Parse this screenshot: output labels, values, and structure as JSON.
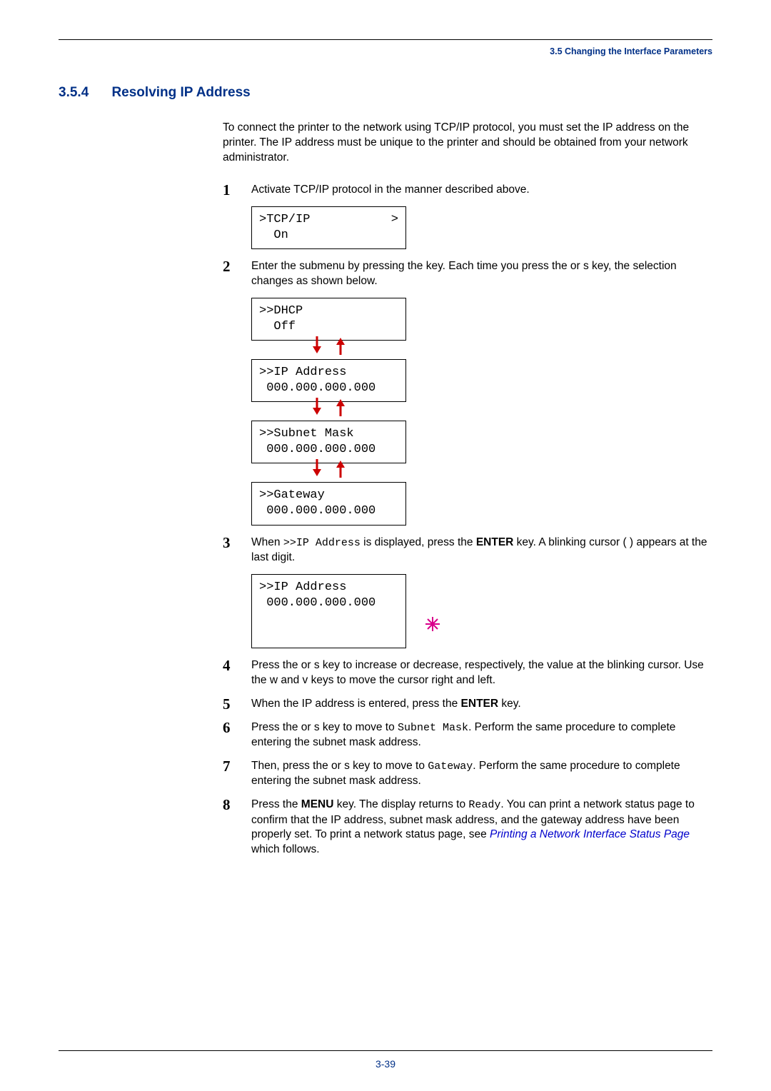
{
  "running_head": "3.5 Changing the Interface Parameters",
  "section": {
    "num": "3.5.4",
    "title": "Resolving IP Address"
  },
  "intro": "To connect the printer to the network using TCP/IP protocol, you must set the IP address on the printer. The IP address must be unique to the printer and should be obtained from your network administrator.",
  "steps": {
    "s1": {
      "num": "1",
      "text": "Activate TCP/IP protocol in the manner described above.",
      "lcd_l1": ">TCP/IP",
      "lcd_gt": ">",
      "lcd_l2": "  On"
    },
    "s2": {
      "num": "2",
      "pre": "Enter the submenu by pressing the ",
      "post": " key. Each time you press the  or s  key, the selection changes as shown below.",
      "lcd_a_l1": ">>DHCP",
      "lcd_a_l2": "  Off",
      "lcd_b_l1": ">>IP Address",
      "lcd_b_l2": " 000.000.000.000",
      "lcd_c_l1": ">>Subnet Mask",
      "lcd_c_l2": " 000.000.000.000",
      "lcd_d_l1": ">>Gateway",
      "lcd_d_l2": " 000.000.000.000"
    },
    "s3": {
      "num": "3",
      "pre": "When ",
      "mono": ">>IP Address",
      "mid": " is displayed, press the ",
      "enter": "ENTER",
      "post": " key. A blinking cursor (  ) appears at the last digit.",
      "lcd_l1": ">>IP Address",
      "lcd_l2": " 000.000.000.000"
    },
    "s4": {
      "num": "4",
      "text": "Press the  or s  key to increase or decrease, respectively, the value at the blinking cursor. Use the w and v  keys to move the cursor right and left."
    },
    "s5": {
      "num": "5",
      "pre": "When the IP address is entered, press the ",
      "enter": "ENTER",
      "post": " key."
    },
    "s6": {
      "num": "6",
      "pre": "Press the  or s  key to move to ",
      "mono": "Subnet Mask",
      "post": ". Perform the same procedure to complete entering the subnet mask address."
    },
    "s7": {
      "num": "7",
      "pre": "Then, press the  or s  key to move to ",
      "mono": "Gateway",
      "post": ". Perform the same procedure to complete entering the subnet mask address."
    },
    "s8": {
      "num": "8",
      "pre": "Press the ",
      "menu": "MENU",
      "mid": " key. The display returns to ",
      "mono": "Ready",
      "post1": ". You can print a network status page to confirm that the IP address, subnet mask address, and the gateway address have been properly set. To print a network status page, see ",
      "link": "Printing a Network Interface Status Page",
      "post2": " which follows."
    }
  },
  "page_number": "3-39"
}
